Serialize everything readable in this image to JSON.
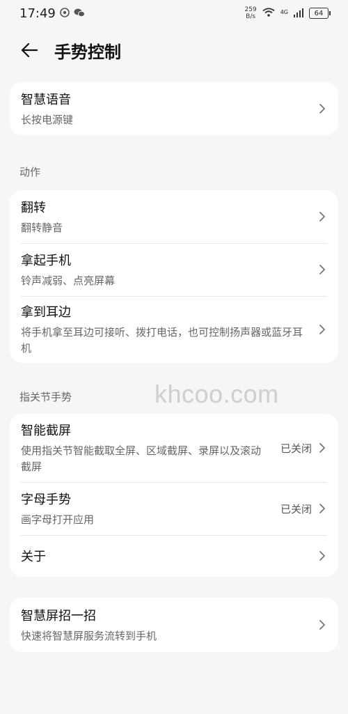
{
  "status_bar": {
    "time": "17:49",
    "speed_value": "259",
    "speed_unit": "B/s",
    "network": "4G",
    "battery": "64"
  },
  "header": {
    "title": "手势控制"
  },
  "voice": {
    "title": "智慧语音",
    "subtitle": "长按电源键"
  },
  "actions": {
    "section_label": "动作",
    "items": [
      {
        "title": "翻转",
        "subtitle": "翻转静音"
      },
      {
        "title": "拿起手机",
        "subtitle": "铃声减弱、点亮屏幕"
      },
      {
        "title": "拿到耳边",
        "subtitle": "将手机拿至耳边可接听、拨打电话，也可控制扬声器或蓝牙耳机"
      }
    ]
  },
  "knuckle": {
    "section_label": "指关节手势",
    "items": [
      {
        "title": "智能截屏",
        "subtitle": "使用指关节智能截取全屏、区域截屏、录屏以及滚动截屏",
        "value": "已关闭"
      },
      {
        "title": "字母手势",
        "subtitle": "画字母打开应用",
        "value": "已关闭"
      },
      {
        "title": "关于"
      }
    ]
  },
  "smart_screen": {
    "title": "智慧屏招一招",
    "subtitle": "快速将智慧屏服务流转到手机"
  },
  "watermark": "khcoo.com"
}
